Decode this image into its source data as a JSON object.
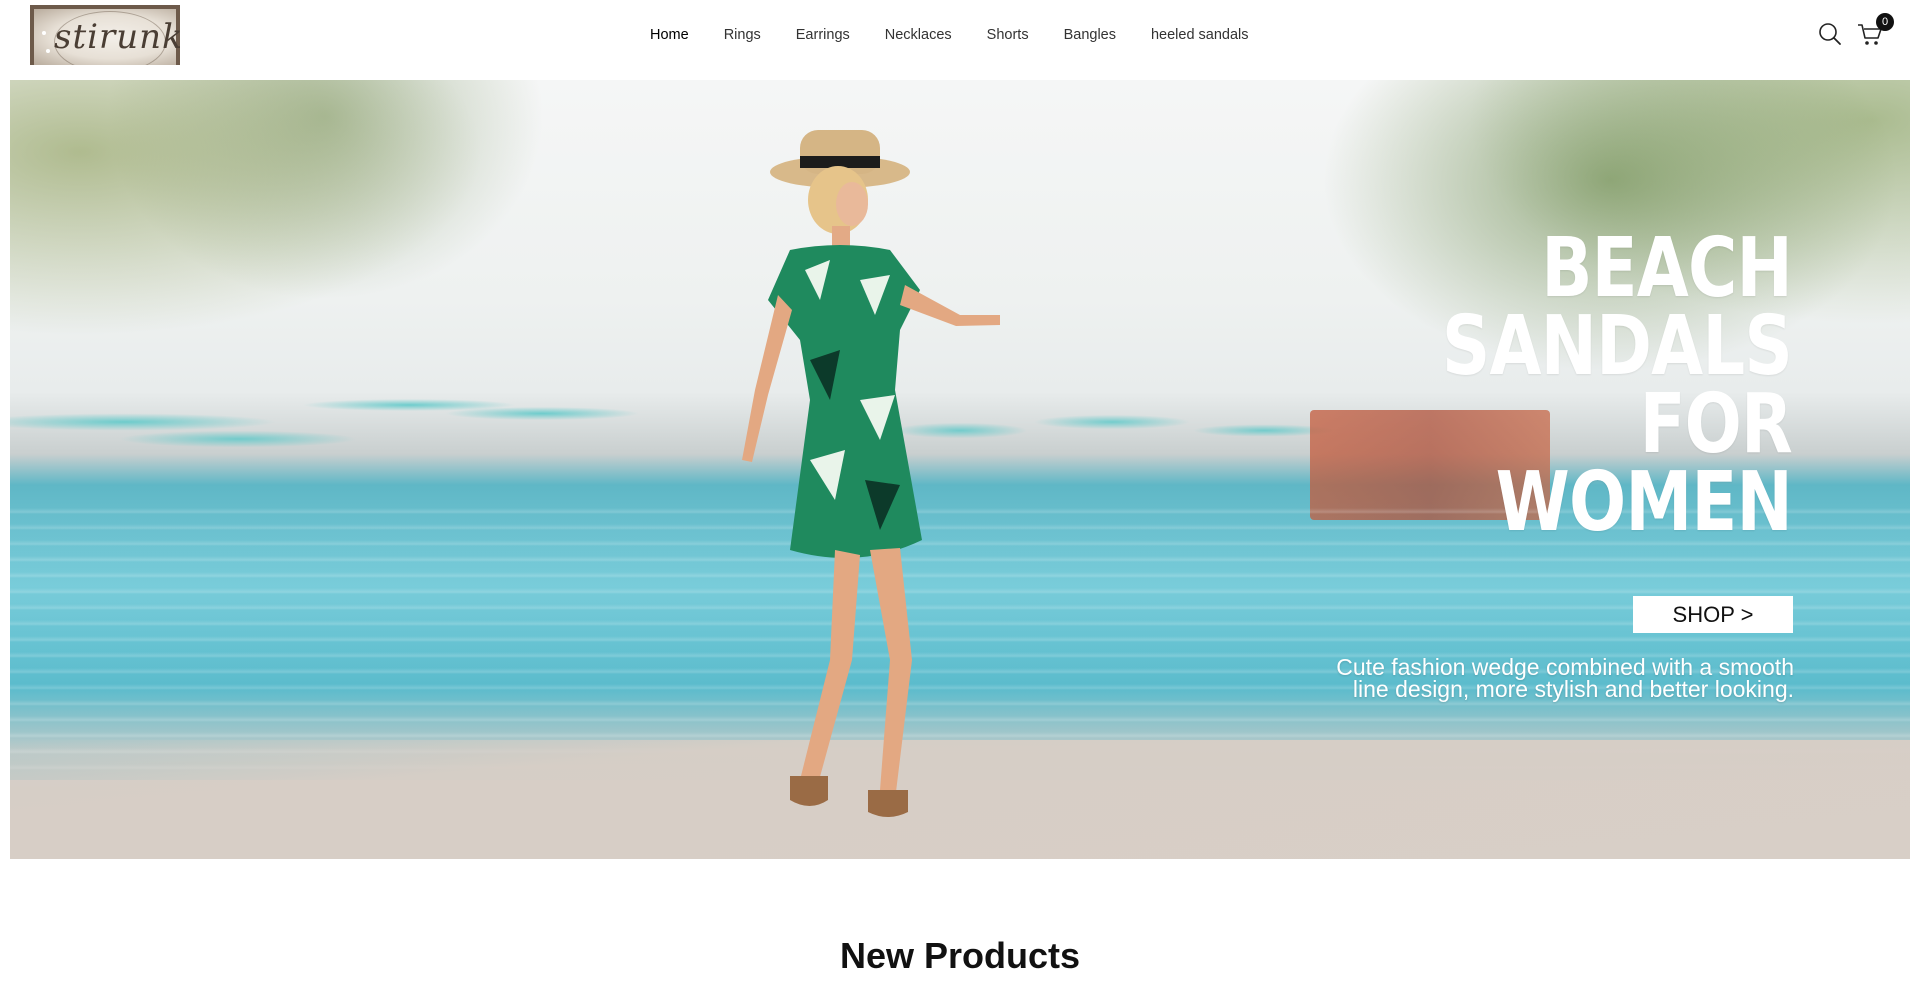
{
  "header": {
    "logo_text": "stirunk",
    "nav": [
      {
        "label": "Home",
        "active": true
      },
      {
        "label": "Rings"
      },
      {
        "label": "Earrings"
      },
      {
        "label": "Necklaces"
      },
      {
        "label": "Shorts"
      },
      {
        "label": "Bangles"
      },
      {
        "label": "heeled sandals"
      }
    ],
    "search_icon": "search-icon",
    "cart_icon": "cart-icon",
    "cart_count": "0"
  },
  "hero": {
    "headline_lines": [
      "BEACH",
      "SANDALS",
      "FOR",
      "WOMEN"
    ],
    "button_label": "SHOP >",
    "subtitle_lines": [
      "Cute fashion wedge combined with a smooth",
      "line design, more stylish and better looking."
    ]
  },
  "sections": {
    "new_products_title": "New Products"
  },
  "colors": {
    "accent": "#111111",
    "hero_text": "#ffffff",
    "pool": "#6cc6d4"
  }
}
